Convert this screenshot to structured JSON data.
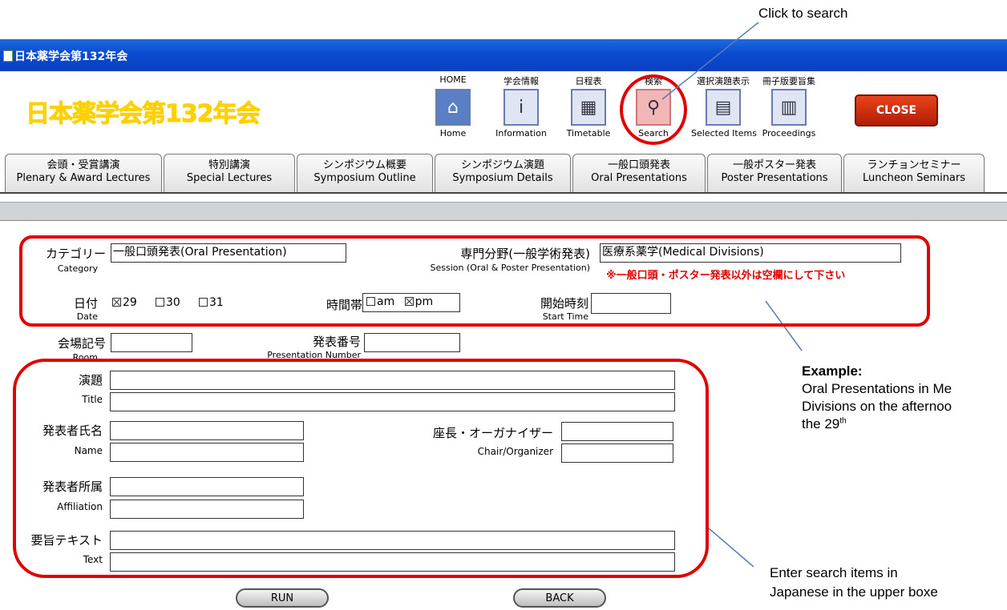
{
  "window": {
    "title": "日本薬学会第132年会"
  },
  "header": {
    "brand": "日本薬学会第132年会",
    "nav": [
      {
        "top": "HOME",
        "bottom": "Home",
        "icon": "home-icon",
        "glyph": "⌂"
      },
      {
        "top": "学会情報",
        "bottom": "Information",
        "icon": "info-icon",
        "glyph": "i"
      },
      {
        "top": "日程表",
        "bottom": "Timetable",
        "icon": "calendar-icon",
        "glyph": "▦"
      },
      {
        "top": "検索",
        "bottom": "Search",
        "icon": "search-icon",
        "glyph": "⚲"
      },
      {
        "top": "選択演題表示",
        "bottom": "Selected Items",
        "icon": "document-icon",
        "glyph": "▤"
      },
      {
        "top": "冊子版要旨集",
        "bottom": "Proceedings",
        "icon": "book-icon",
        "glyph": "▥"
      }
    ],
    "close_label": "CLOSE"
  },
  "tabs": [
    {
      "jp": "会頭・受賞講演",
      "en": "Plenary & Award Lectures"
    },
    {
      "jp": "特別講演",
      "en": "Special Lectures"
    },
    {
      "jp": "シンポジウム概要",
      "en": "Symposium Outline"
    },
    {
      "jp": "シンポジウム演題",
      "en": "Symposium Details"
    },
    {
      "jp": "一般口頭発表",
      "en": "Oral Presentations"
    },
    {
      "jp": "一般ポスター発表",
      "en": "Poster Presentations"
    },
    {
      "jp": "ランチョンセミナー",
      "en": "Luncheon Seminars"
    }
  ],
  "form": {
    "category": {
      "jp": "カテゴリー",
      "en": "Category",
      "value": "一般口頭発表(Oral Presentation)"
    },
    "session": {
      "jp": "専門分野(一般学術発表)",
      "en": "Session (Oral & Poster Presentation)",
      "value": "医療系薬学(Medical Divisions)"
    },
    "note": "※一般口頭・ポスター発表以外は空欄にして下さい",
    "date": {
      "jp": "日付",
      "en": "Date",
      "options": [
        {
          "label": "29",
          "checked": true
        },
        {
          "label": "30",
          "checked": false
        },
        {
          "label": "31",
          "checked": false
        }
      ]
    },
    "time_slot": {
      "jp": "時間帯",
      "options": [
        {
          "label": "am",
          "checked": false
        },
        {
          "label": "pm",
          "checked": true
        }
      ]
    },
    "start_time": {
      "jp": "開始時刻",
      "en": "Start Time",
      "value": ""
    },
    "room": {
      "jp": "会場記号",
      "en": "Room",
      "value": ""
    },
    "presentation_number": {
      "jp": "発表番号",
      "en": "Presentation Number",
      "value": ""
    },
    "title": {
      "jp": "演題",
      "en": "Title"
    },
    "name": {
      "jp": "発表者氏名",
      "en": "Name"
    },
    "chair": {
      "jp": "座長・オーガナイザー",
      "en": "Chair/Organizer"
    },
    "affiliation": {
      "jp": "発表者所属",
      "en": "Affiliation"
    },
    "text": {
      "jp": "要旨テキスト",
      "en": "Text"
    },
    "run_label": "RUN",
    "back_label": "BACK"
  },
  "annotations": {
    "click_to_search": "Click to search",
    "example_heading": "Example:",
    "example_line1": "Oral Presentations in Me",
    "example_line2": "Divisions on the afternoo",
    "example_line3": "the 29",
    "example_sup": "th",
    "enter_line1": "Enter search items in",
    "enter_line2": "Japanese in the upper boxe"
  },
  "colors": {
    "titlebar": "#0a4bd0",
    "brand": "#ffd000",
    "close": "#c8290c",
    "highlight": "#e00000",
    "callout_line": "#5a7db8"
  }
}
